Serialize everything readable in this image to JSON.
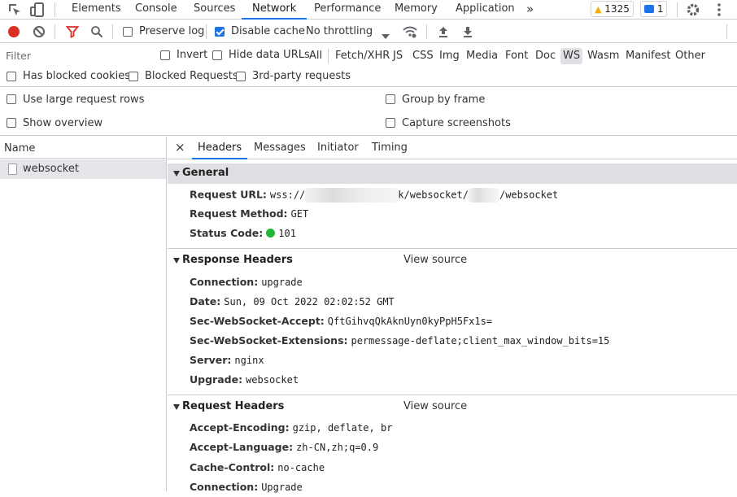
{
  "tabs": [
    {
      "label": "Elements"
    },
    {
      "label": "Console"
    },
    {
      "label": "Sources"
    },
    {
      "label": "Network"
    },
    {
      "label": "Performance"
    },
    {
      "label": "Memory"
    },
    {
      "label": "Application"
    }
  ],
  "more_tabs_glyph": "»",
  "warnings_count": "1325",
  "messages_count": "1",
  "toolbar": {
    "preserve_log": "Preserve log",
    "disable_cache": "Disable cache",
    "throttling": "No throttling"
  },
  "filter": {
    "placeholder": "Filter",
    "invert": "Invert",
    "hide_data_urls": "Hide data URLs",
    "types": [
      "All",
      "Fetch/XHR",
      "JS",
      "CSS",
      "Img",
      "Media",
      "Font",
      "Doc",
      "WS",
      "Wasm",
      "Manifest",
      "Other"
    ],
    "selected_type": "WS"
  },
  "blocked": {
    "has_blocked_cookies": "Has blocked cookies",
    "blocked_requests": "Blocked Requests",
    "third_party": "3rd-party requests"
  },
  "settings": {
    "large_rows": "Use large request rows",
    "show_overview": "Show overview",
    "group_by_frame": "Group by frame",
    "capture_screenshots": "Capture screenshots"
  },
  "requests": {
    "name_header": "Name",
    "items": [
      {
        "name": "websocket"
      }
    ]
  },
  "detail": {
    "close_glyph": "×",
    "tabs": [
      "Headers",
      "Messages",
      "Initiator",
      "Timing"
    ],
    "general": {
      "title": "General",
      "request_url_key": "Request URL:",
      "request_url_prefix": "wss://",
      "request_url_mid": "k/websocket/",
      "request_url_suffix": "/websocket",
      "request_method_key": "Request Method:",
      "request_method": "GET",
      "status_code_key": "Status Code:",
      "status_code": "101",
      "status_color": "#1fb836"
    },
    "response_headers": {
      "title": "Response Headers",
      "view_source": "View source",
      "rows": [
        {
          "key": "Connection:",
          "value": "upgrade"
        },
        {
          "key": "Date:",
          "value": "Sun, 09 Oct 2022 02:02:52 GMT"
        },
        {
          "key": "Sec-WebSocket-Accept:",
          "value": "QftGihvqQkAknUyn0kyPpH5Fx1s="
        },
        {
          "key": "Sec-WebSocket-Extensions:",
          "value": "permessage-deflate;client_max_window_bits=15"
        },
        {
          "key": "Server:",
          "value": "nginx"
        },
        {
          "key": "Upgrade:",
          "value": "websocket"
        }
      ]
    },
    "request_headers": {
      "title": "Request Headers",
      "view_source": "View source",
      "rows": [
        {
          "key": "Accept-Encoding:",
          "value": "gzip, deflate, br"
        },
        {
          "key": "Accept-Language:",
          "value": "zh-CN,zh;q=0.9"
        },
        {
          "key": "Cache-Control:",
          "value": "no-cache"
        },
        {
          "key": "Connection:",
          "value": "Upgrade"
        }
      ]
    }
  },
  "colors": {
    "accent": "#1a73e8",
    "record_red": "#d93025",
    "filter_red": "#d93025",
    "warning_yellow": "#f9ab00"
  }
}
